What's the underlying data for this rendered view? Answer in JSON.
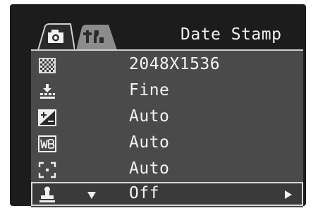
{
  "header": {
    "title": "Date Stamp",
    "tabs": [
      {
        "icon": "camera-icon",
        "active": true
      },
      {
        "icon": "setup-icon",
        "active": false
      }
    ]
  },
  "menu": {
    "items": [
      {
        "icon": "resolution-icon",
        "value": "2048X1536"
      },
      {
        "icon": "quality-icon",
        "value": "Fine"
      },
      {
        "icon": "exposure-compensation-icon",
        "value": "Auto"
      },
      {
        "icon": "white-balance-icon",
        "value": "Auto"
      },
      {
        "icon": "metering-icon",
        "value": "Auto"
      },
      {
        "icon": "date-stamp-icon",
        "value": "Off",
        "selected": true
      }
    ]
  }
}
